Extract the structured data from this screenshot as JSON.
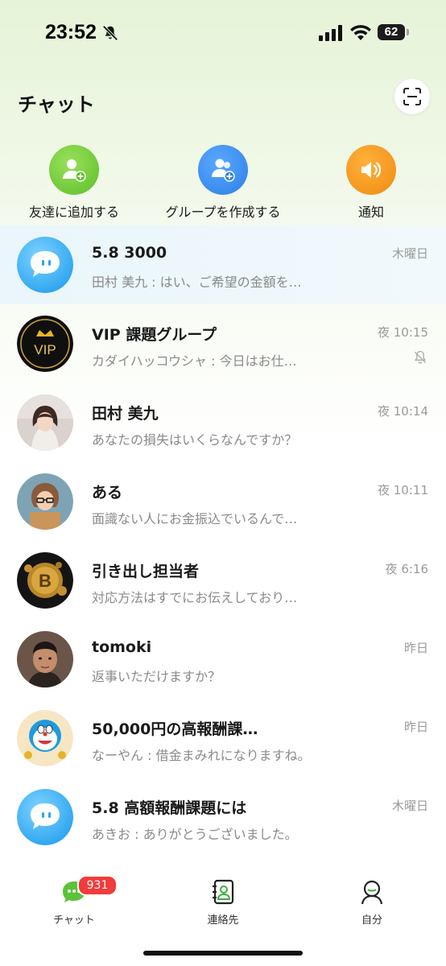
{
  "status_bar": {
    "time": "23:52",
    "battery": "62"
  },
  "header": {
    "title": "チャット",
    "scan_icon": "scan-icon"
  },
  "quick_actions": [
    {
      "label": "友達に追加する",
      "icon": "add-friend-icon",
      "color": "#7ccf3b"
    },
    {
      "label": "グループを作成する",
      "icon": "create-group-icon",
      "color": "#3a8ef0"
    },
    {
      "label": "通知",
      "icon": "speaker-icon",
      "color": "#f59a1b"
    }
  ],
  "chats": [
    {
      "name": "5.8  3000",
      "preview": "田村 美九 : はい、ご希望の金額を…",
      "time": "木曜日",
      "avatar": "chat-bubble-avatar",
      "highlighted": true
    },
    {
      "name": "VIP 課題グループ",
      "preview": "カダイハッコウシャ : 今日はお仕…",
      "time": "夜 10:15",
      "avatar": "vip-crown-avatar",
      "muted": true
    },
    {
      "name": "田村 美九",
      "preview": "あなたの損失はいくらなんですか？",
      "time": "夜 10:14",
      "avatar": "woman-photo-avatar"
    },
    {
      "name": "ある",
      "preview": "面識ない人にお金振込でいるんで…",
      "time": "夜 10:11",
      "avatar": "cartoon-avatar"
    },
    {
      "name": "引き出し担当者",
      "preview": "対応方法はすでにお伝えしており…",
      "time": "夜 6:16",
      "avatar": "bitcoin-avatar"
    },
    {
      "name": "tomoki",
      "preview": "返事いただけますか？",
      "time": "昨日",
      "avatar": "man-photo-avatar"
    },
    {
      "name": "50,000円の高報酬課…",
      "preview": "なーやん : 借金まみれになりますね。",
      "time": "昨日",
      "avatar": "doraemon-avatar"
    },
    {
      "name": "5.8  高額報酬課題には",
      "preview": "あきお : ありがとうございました。",
      "time": "木曜日",
      "avatar": "chat-bubble-avatar"
    }
  ],
  "tab_bar": {
    "tabs": [
      {
        "label": "チャット",
        "icon": "chat-tab-icon",
        "active": true
      },
      {
        "label": "連絡先",
        "icon": "contacts-tab-icon"
      },
      {
        "label": "自分",
        "icon": "profile-tab-icon"
      }
    ],
    "chat_badge": "931"
  },
  "colors": {
    "accent_green": "#5cc23a",
    "badge_red": "#f23b3b"
  }
}
